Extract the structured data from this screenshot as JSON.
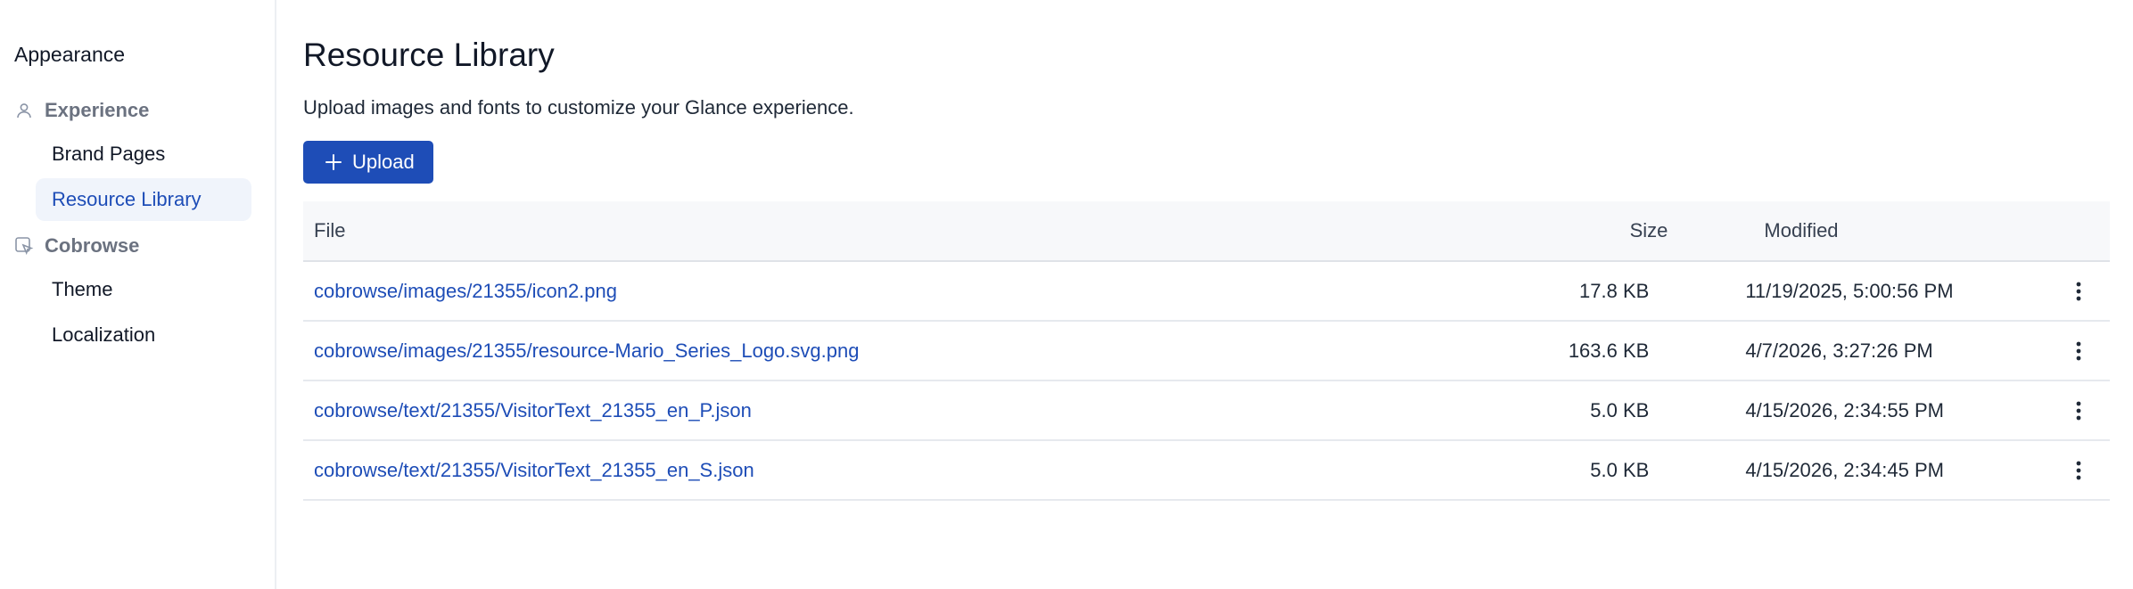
{
  "sidebar": {
    "title": "Appearance",
    "groups": [
      {
        "label": "Experience",
        "icon": "user-icon",
        "items": [
          {
            "label": "Brand Pages",
            "active": false
          },
          {
            "label": "Resource Library",
            "active": true
          }
        ]
      },
      {
        "label": "Cobrowse",
        "icon": "cobrowse-cursor-icon",
        "items": [
          {
            "label": "Theme",
            "active": false
          },
          {
            "label": "Localization",
            "active": false
          }
        ]
      }
    ]
  },
  "main": {
    "title": "Resource Library",
    "description": "Upload images and fonts to customize your Glance experience.",
    "upload_label": "Upload",
    "upload_icon": "plus-icon",
    "table": {
      "headers": {
        "file": "File",
        "size": "Size",
        "modified": "Modified"
      },
      "rows": [
        {
          "file": "cobrowse/images/21355/icon2.png",
          "size": "17.8 KB",
          "modified": "11/19/2025, 5:00:56 PM"
        },
        {
          "file": "cobrowse/images/21355/resource-Mario_Series_Logo.svg.png",
          "size": "163.6 KB",
          "modified": "4/7/2026, 3:27:26 PM"
        },
        {
          "file": "cobrowse/text/21355/VisitorText_21355_en_P.json",
          "size": "5.0 KB",
          "modified": "4/15/2026, 2:34:55 PM"
        },
        {
          "file": "cobrowse/text/21355/VisitorText_21355_en_S.json",
          "size": "5.0 KB",
          "modified": "4/15/2026, 2:34:45 PM"
        }
      ]
    }
  },
  "colors": {
    "accent": "#1e4db7",
    "active_nav_bg": "#f0f4fb",
    "table_header_bg": "#f7f8fa",
    "muted_text": "#6b7280"
  }
}
